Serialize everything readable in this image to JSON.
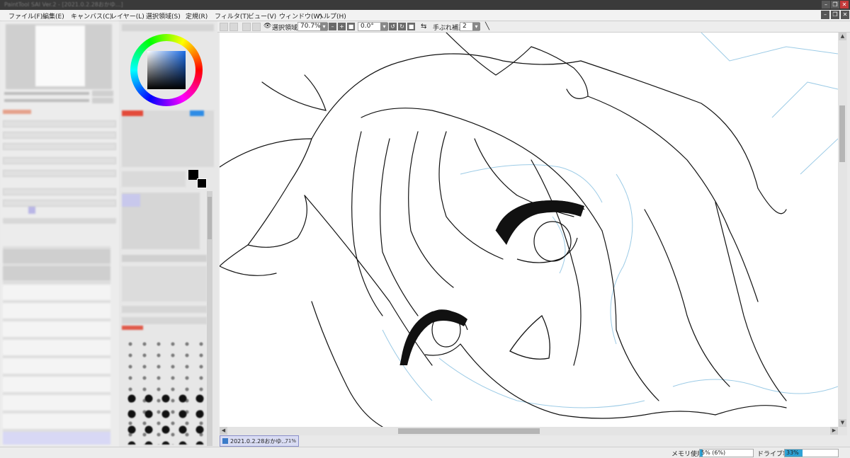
{
  "app": {
    "title": "PaintTool SAI Ver.2 - [2021.0.2.28おかゆ...]",
    "accent": "#2ea3d6"
  },
  "menu": {
    "items": [
      "ファイル(F)",
      "編集(E)",
      "キャンバス(C)",
      "レイヤー(L)",
      "選択領域(S)",
      "定規(R)",
      "フィルタ(T)",
      "ビュー(V)",
      "ウィンドウ(W)",
      "ヘルプ(H)"
    ]
  },
  "toolbar": {
    "selection_label": "選択領域",
    "zoom_value": "70.7%",
    "angle_value": "0.0°",
    "stabilizer_label": "手ぶれ補正",
    "stabilizer_value": "2"
  },
  "document_tab": {
    "name": "2021.0.2.28おかゆ...",
    "percent": "71%"
  },
  "status": {
    "memory_label": "メモリ使用量",
    "memory_value": "5% (6%)",
    "memory_fraction": 0.05,
    "drive_label": "ドライブ容量",
    "drive_value": "33%",
    "drive_fraction": 0.33
  },
  "icons": {
    "window_minimize": "minimize-icon",
    "window_restore": "restore-icon",
    "window_close": "close-icon",
    "eye": "eye-icon",
    "flip": "flip-icon",
    "line_tool": "line-icon"
  }
}
